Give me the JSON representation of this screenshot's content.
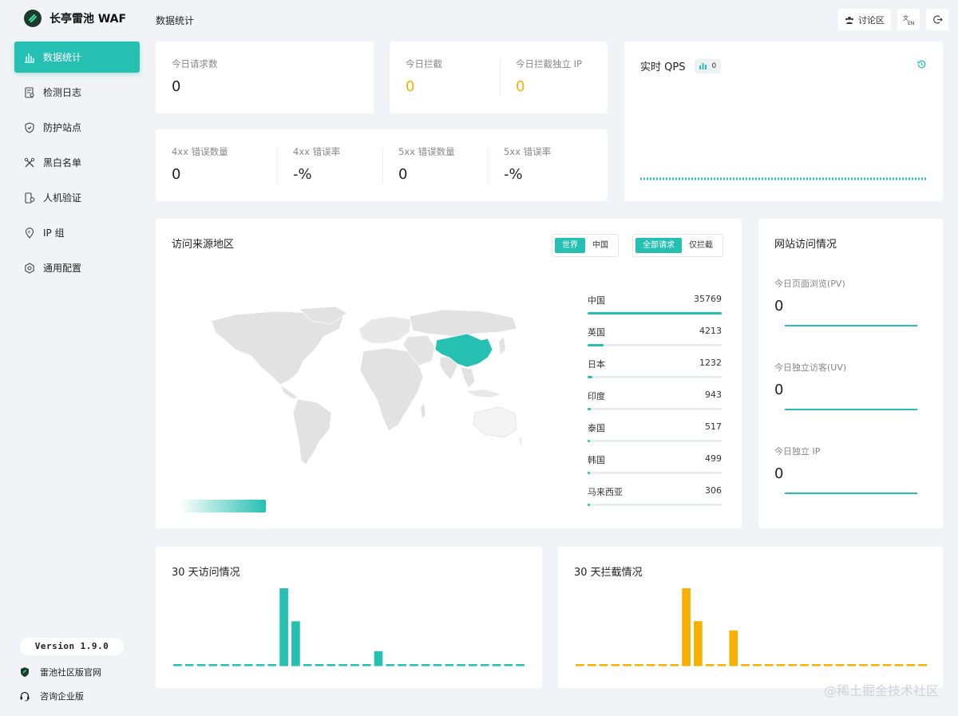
{
  "brand": {
    "name": "长亭雷池 WAF"
  },
  "sidebar": {
    "items": [
      {
        "label": "数据统计",
        "icon": "bar-chart-icon",
        "active": true
      },
      {
        "label": "检测日志",
        "icon": "log-icon",
        "active": false
      },
      {
        "label": "防护站点",
        "icon": "shield-icon",
        "active": false
      },
      {
        "label": "黑白名单",
        "icon": "tools-icon",
        "active": false
      },
      {
        "label": "人机验证",
        "icon": "verify-icon",
        "active": false
      },
      {
        "label": "IP 组",
        "icon": "ip-icon",
        "active": false
      },
      {
        "label": "通用配置",
        "icon": "gear-icon",
        "active": false
      }
    ],
    "version": "Version 1.9.0",
    "community_link": "雷池社区版官网",
    "enterprise_link": "咨询企业版"
  },
  "header": {
    "title": "数据统计",
    "discuss_label": "讨论区"
  },
  "stats": {
    "requests_label": "今日请求数",
    "requests_value": "0",
    "blocked_label": "今日拦截",
    "blocked_value": "0",
    "blocked_ip_label": "今日拦截独立 IP",
    "blocked_ip_value": "0",
    "err4_label": "4xx 错误数量",
    "err4_value": "0",
    "err4_rate_label": "4xx 错误率",
    "err4_rate_value": "-%",
    "err5_label": "5xx 错误数量",
    "err5_value": "0",
    "err5_rate_label": "5xx 错误率",
    "err5_rate_value": "-%"
  },
  "qps": {
    "title": "实时 QPS",
    "value": "0"
  },
  "geo": {
    "title": "访问来源地区",
    "scope_options": [
      "世界",
      "中国"
    ],
    "scope_selected": "世界",
    "filter_options": [
      "全部请求",
      "仅拦截"
    ],
    "filter_selected": "全部请求",
    "rank": [
      {
        "name": "中国",
        "value": 35769
      },
      {
        "name": "英国",
        "value": 4213
      },
      {
        "name": "日本",
        "value": 1232
      },
      {
        "name": "印度",
        "value": 943
      },
      {
        "name": "泰国",
        "value": 517
      },
      {
        "name": "韩国",
        "value": 499
      },
      {
        "name": "马来西亚",
        "value": 306
      }
    ]
  },
  "site": {
    "title": "网站访问情况",
    "pv_label": "今日页面浏览(PV)",
    "pv_value": "0",
    "uv_label": "今日独立访客(UV)",
    "uv_value": "0",
    "ip_label": "今日独立 IP",
    "ip_value": "0"
  },
  "visits30": {
    "title": "30 天访问情况",
    "color": "#25c0b2"
  },
  "blocks30": {
    "title": "30 天拦截情况",
    "color": "#f5b000"
  },
  "chart_data": [
    {
      "type": "bar",
      "values": [
        0,
        0,
        0,
        0,
        0,
        0,
        0,
        0,
        0,
        100,
        57,
        0,
        0,
        0,
        0,
        0,
        0,
        18,
        0,
        0,
        0,
        0,
        0,
        0,
        0,
        0,
        0,
        0,
        0,
        0
      ]
    },
    {
      "type": "bar",
      "values": [
        0,
        0,
        0,
        0,
        0,
        0,
        0,
        0,
        0,
        100,
        57,
        0,
        0,
        45,
        0,
        0,
        0,
        0,
        0,
        0,
        0,
        0,
        0,
        0,
        0,
        0,
        0,
        0,
        0,
        0
      ]
    }
  ],
  "watermark": "@稀土掘金技术社区"
}
